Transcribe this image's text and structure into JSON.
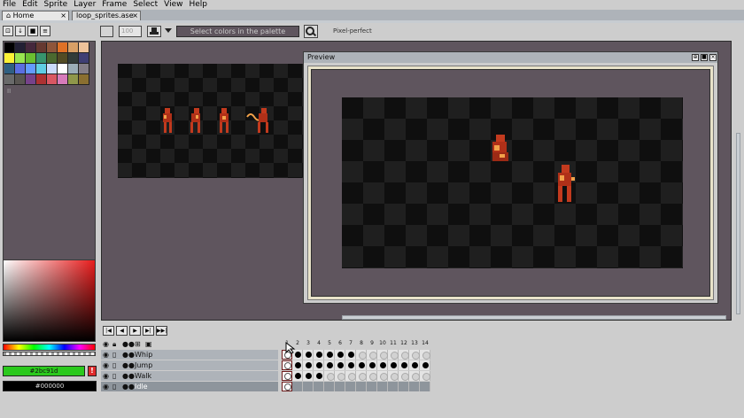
{
  "menu": [
    "File",
    "Edit",
    "Sprite",
    "Layer",
    "Frame",
    "Select",
    "View",
    "Help"
  ],
  "tabs": [
    {
      "label": "Home",
      "close": "×"
    },
    {
      "label": "loop_sprites.ase",
      "close": "×"
    }
  ],
  "toolbar": {
    "tolerance_placeholder": "100",
    "select_colors_label": "Select colors in the palette",
    "pixel_perfect_label": "Pixel-perfect"
  },
  "palette": {
    "index_label": "II",
    "colors": [
      "#000000",
      "#222034",
      "#45283c",
      "#663931",
      "#8f563b",
      "#df7126",
      "#d9a066",
      "#eec39a",
      "#fbf236",
      "#99e550",
      "#6abe30",
      "#37946e",
      "#4b692f",
      "#524b24",
      "#323c39",
      "#3f3f74",
      "#306082",
      "#5b6ee1",
      "#639bff",
      "#5fcde4",
      "#cbdbfc",
      "#ffffff",
      "#9badb7",
      "#847e87",
      "#696a6a",
      "#595652",
      "#76428a",
      "#ac3232",
      "#d95763",
      "#d77bba",
      "#8f974a",
      "#8a6f30"
    ]
  },
  "colors": {
    "foreground_hex": "#2bc91d",
    "background_hex": "#000000",
    "accent": "#5f555e"
  },
  "preview": {
    "title": "Preview",
    "buttons": [
      "⊕",
      "■",
      "×"
    ]
  },
  "timeline": {
    "controls": [
      "|◀",
      "◀",
      "▶",
      "▶|",
      "▶▶|"
    ],
    "frame_numbers": [
      "1",
      "2",
      "3",
      "4",
      "5",
      "6",
      "7",
      "8",
      "9",
      "10",
      "11",
      "12",
      "13",
      "14"
    ],
    "layers": [
      {
        "name": "Whip",
        "cels": [
          1,
          1,
          1,
          1,
          1,
          1,
          1,
          0,
          0,
          0,
          0,
          0,
          0,
          0
        ],
        "selected": false
      },
      {
        "name": "Jump",
        "cels": [
          1,
          1,
          1,
          1,
          1,
          1,
          1,
          1,
          1,
          1,
          1,
          1,
          1,
          1
        ],
        "selected": false
      },
      {
        "name": "Walk",
        "cels": [
          1,
          1,
          1,
          1,
          0,
          0,
          0,
          0,
          0,
          0,
          0,
          0,
          0,
          0
        ],
        "selected": false
      },
      {
        "name": "Idle",
        "cels": [
          1,
          0,
          0,
          0,
          0,
          0,
          0,
          0,
          0,
          0,
          0,
          0,
          0,
          0
        ],
        "selected": true
      }
    ]
  }
}
